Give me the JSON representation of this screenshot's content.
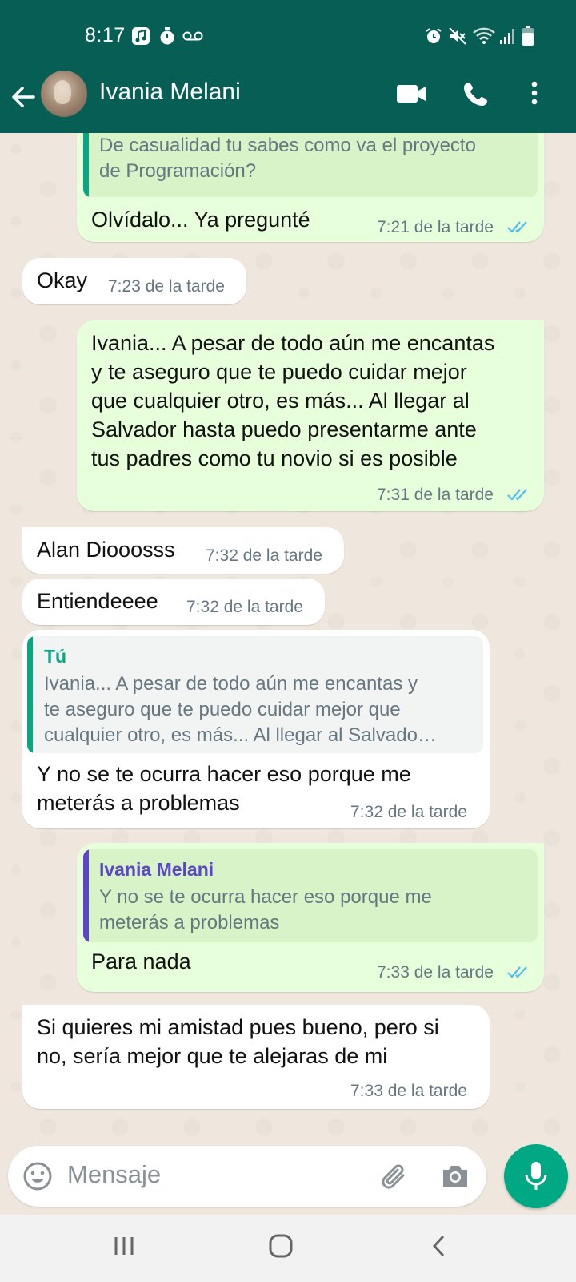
{
  "status_bar": {
    "time": "8:17"
  },
  "header": {
    "contact_name": "Ivania Melani"
  },
  "messages": [
    {
      "direction": "out",
      "quote_text": [
        "De casualidad tu sabes como va el proyecto",
        "de Programación?"
      ],
      "text": [
        "Olvídalo... Ya pregunté"
      ],
      "time": "7:21 de la tarde",
      "read": true
    },
    {
      "direction": "in",
      "text": [
        "Okay"
      ],
      "time": "7:23 de la tarde"
    },
    {
      "direction": "out",
      "text": [
        "Ivania... A pesar de todo aún me encantas",
        "y te aseguro que te puedo cuidar mejor",
        "que cualquier otro, es más... Al llegar al",
        "Salvador hasta puedo presentarme ante",
        "tus padres como tu novio si es posible"
      ],
      "time": "7:31 de la tarde",
      "read": true
    },
    {
      "direction": "in",
      "text": [
        "Alan Diooosss"
      ],
      "time": "7:32 de la tarde"
    },
    {
      "direction": "in",
      "text": [
        "Entiendeeee"
      ],
      "time": "7:32 de la tarde"
    },
    {
      "direction": "in",
      "quote_name": "Tú",
      "quote_text": [
        "Ivania... A pesar de todo aún me encantas y",
        "te aseguro que te puedo cuidar mejor que",
        "cualquier otro, es más... Al llegar al Salvado…"
      ],
      "text": [
        "Y no se te ocurra hacer eso porque me",
        "meterás a problemas"
      ],
      "time": "7:32 de la tarde"
    },
    {
      "direction": "out",
      "quote_name": "Ivania Melani",
      "quote_text": [
        "Y no se te ocurra hacer eso porque me",
        "meterás a problemas"
      ],
      "text": [
        "Para nada"
      ],
      "time": "7:33 de la tarde",
      "read": true
    },
    {
      "direction": "in",
      "text": [
        "Si quieres mi amistad pues bueno, pero si",
        "no, sería mejor que te alejaras de mi"
      ],
      "time": "7:33 de la tarde"
    }
  ],
  "composer": {
    "placeholder": "Mensaje"
  },
  "colors": {
    "header_bg": "#075e54",
    "outgoing_bubble": "#e7ffdb",
    "incoming_bubble": "#ffffff",
    "read_ticks": "#53bdeb",
    "quote_you": "#06a884",
    "quote_contact": "#5b45c9",
    "mic_button": "#00a884"
  }
}
